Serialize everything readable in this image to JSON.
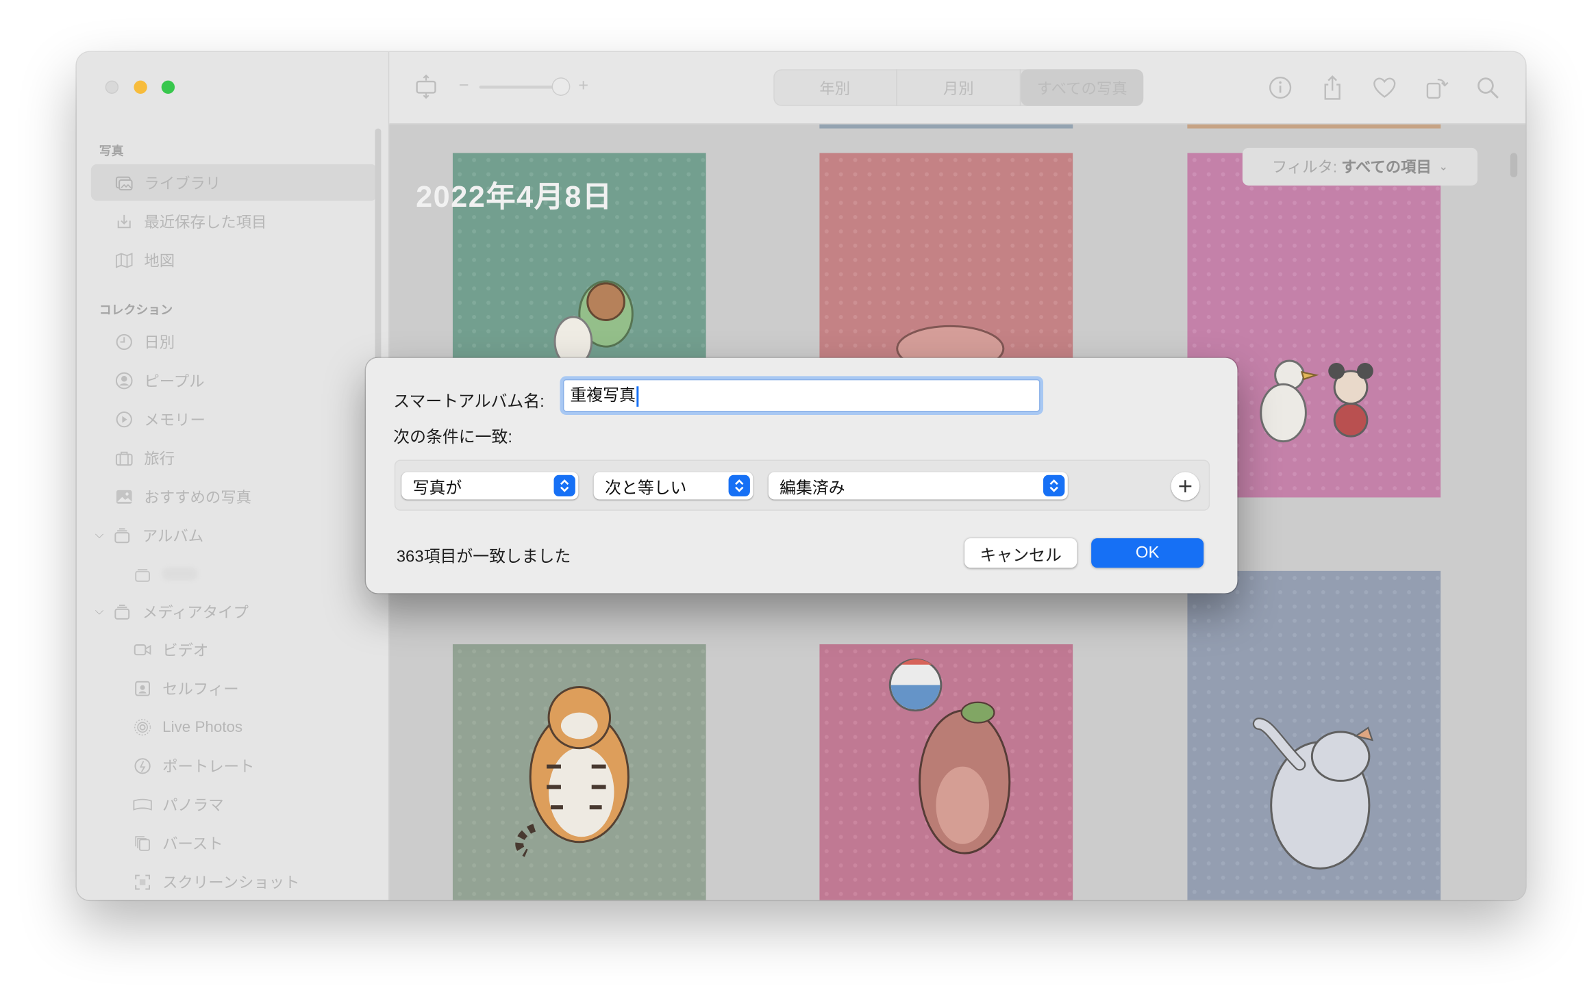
{
  "window": {
    "traffic_lights": {
      "close": "#d9d9d9",
      "minimize": "#fdbb2d",
      "zoom": "#29c840"
    }
  },
  "sidebar": {
    "section_photos": "写真",
    "library": "ライブラリ",
    "recently_saved": "最近保存した項目",
    "map": "地図",
    "section_collections": "コレクション",
    "days": "日別",
    "people": "ピープル",
    "memories": "メモリー",
    "trips": "旅行",
    "featured": "おすすめの写真",
    "albums": "アルバム",
    "media_types": "メディアタイプ",
    "videos": "ビデオ",
    "selfies": "セルフィー",
    "live_photos": "Live Photos",
    "portrait": "ポートレート",
    "panorama": "パノラマ",
    "burst": "バースト",
    "screenshots": "スクリーンショット"
  },
  "toolbar": {
    "zoom_minus": "−",
    "zoom_plus": "+",
    "zoom_level": 0.85,
    "tabs": [
      "年別",
      "月別",
      "すべての写真"
    ],
    "selected_tab": "すべての写真"
  },
  "content": {
    "date_heading": "2022年4月8日",
    "filter_label": "フィルタ:",
    "filter_value": "すべての項目",
    "tile_colors": [
      "#6a9b89",
      "#c47b7e",
      "#c47aa6",
      "#8ea08f",
      "#c0718e",
      "#8f9aaf"
    ],
    "tile_subjects": [
      "crocodile-and-rabbit",
      "pink-hippo",
      "duck-and-mouse",
      "tiger",
      "bear-with-ball",
      "elephant"
    ]
  },
  "dialog": {
    "name_label": "スマートアルバム名:",
    "name_value": "重複写真",
    "match_label": "次の条件に一致:",
    "condition_field": "写真が",
    "condition_operator": "次と等しい",
    "condition_value": "編集済み",
    "match_count": "363項目が一致しました",
    "cancel_label": "キャンセル",
    "ok_label": "OK",
    "accent": "#1670f5"
  }
}
